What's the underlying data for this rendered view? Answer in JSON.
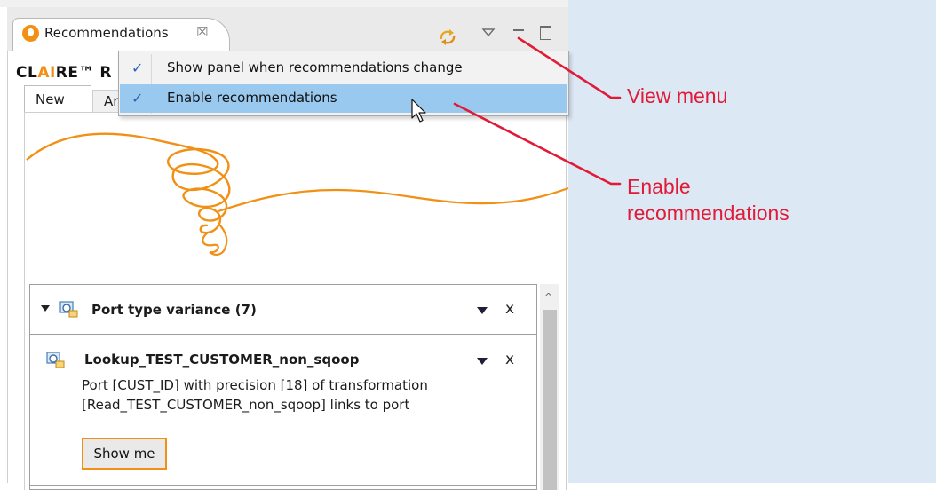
{
  "panel": {
    "tab_title": "Recommendations",
    "tab_close_symbol": "☒",
    "claire_prefix": "CL",
    "claire_highlight": "AI",
    "claire_suffix": "RE™ R",
    "subtabs": [
      "New",
      "Arc"
    ]
  },
  "view_menu": {
    "items": [
      {
        "label": "Show panel when recommendations change",
        "checked": true,
        "check": "✓"
      },
      {
        "label": "Enable recommendations",
        "checked": true,
        "check": "✓",
        "highlighted": true
      }
    ]
  },
  "recommendations": {
    "group": {
      "title": "Port type variance (7)",
      "close": "x"
    },
    "item": {
      "title": "Lookup_TEST_CUSTOMER_non_sqoop",
      "description": "Port [CUST_ID] with precision [18] of transformation [Read_TEST_CUSTOMER_non_sqoop] links to port",
      "button": "Show me",
      "close": "x"
    }
  },
  "annotations": {
    "view_menu": "View menu",
    "enable_line1": "Enable",
    "enable_line2": "recommendations"
  },
  "colors": {
    "accent_orange": "#f19014",
    "menu_highlight": "#99c9ef",
    "annotation_red": "#e11a37",
    "background_right": "#dde8f5"
  },
  "icons": [
    "lightbulb-icon",
    "close-tab-icon",
    "sync-icon",
    "view-menu-icon",
    "minimize-icon",
    "maximize-icon",
    "checkmark-icon",
    "recommendation-icon",
    "mouse-cursor-icon"
  ]
}
